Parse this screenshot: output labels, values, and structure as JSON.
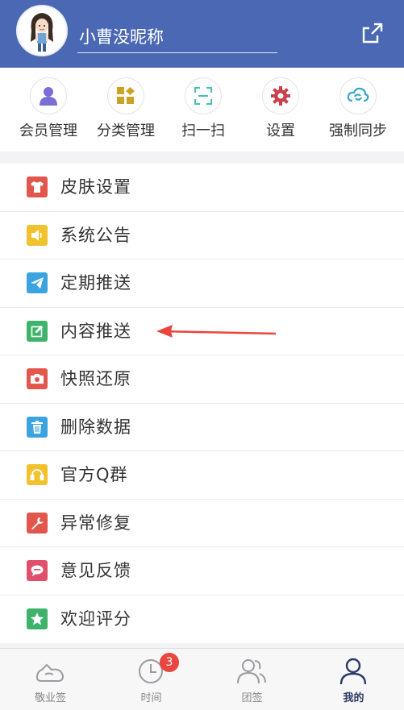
{
  "header": {
    "username": "小曹没昵称",
    "share_icon": "share-icon"
  },
  "quick_actions": [
    {
      "label": "会员管理",
      "icon": "member-icon",
      "color": "#7a6fd6"
    },
    {
      "label": "分类管理",
      "icon": "category-grid-icon",
      "color": "#c9a227"
    },
    {
      "label": "扫一扫",
      "icon": "scan-icon",
      "color": "#44c1b3"
    },
    {
      "label": "设置",
      "icon": "gear-icon",
      "color": "#c8414b"
    },
    {
      "label": "强制同步",
      "icon": "sync-icon",
      "color": "#3aa7c9"
    }
  ],
  "menu": [
    {
      "label": "皮肤设置",
      "icon": "tshirt-icon",
      "color": "#e2574c"
    },
    {
      "label": "系统公告",
      "icon": "speaker-icon",
      "color": "#f2c12e"
    },
    {
      "label": "定期推送",
      "icon": "paper-plane-icon",
      "color": "#3aa3e0"
    },
    {
      "label": "内容推送",
      "icon": "edit-icon",
      "color": "#3fb36b"
    },
    {
      "label": "快照还原",
      "icon": "camera-icon",
      "color": "#e2574c"
    },
    {
      "label": "删除数据",
      "icon": "trash-icon",
      "color": "#3aa3e0"
    },
    {
      "label": "官方Q群",
      "icon": "headset-icon",
      "color": "#f2c12e"
    },
    {
      "label": "异常修复",
      "icon": "wrench-icon",
      "color": "#e2574c"
    },
    {
      "label": "意见反馈",
      "icon": "chat-bubble-icon",
      "color": "#e0506b"
    },
    {
      "label": "欢迎评分",
      "icon": "star-icon",
      "color": "#3fb36b"
    }
  ],
  "tabs": [
    {
      "label": "敬业签",
      "icon": "note-tab-icon"
    },
    {
      "label": "时间",
      "icon": "clock-tab-icon",
      "badge": "3"
    },
    {
      "label": "团签",
      "icon": "group-tab-icon"
    },
    {
      "label": "我的",
      "icon": "profile-tab-icon",
      "active": true
    }
  ],
  "colors": {
    "header_bg": "#4a68b3",
    "accent": "#2b3a66",
    "badge": "#e8463f",
    "annotation_arrow": "#e8463f"
  }
}
